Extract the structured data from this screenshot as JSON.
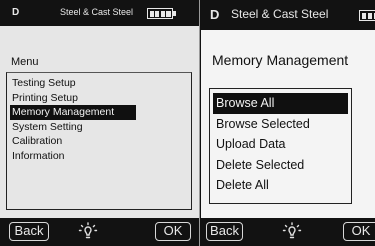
{
  "left_screen": {
    "status": {
      "mode": "D",
      "material": "Steel & Cast Steel",
      "battery_icon": "battery-full-icon"
    },
    "title": "Menu",
    "items": [
      {
        "label": "Testing Setup"
      },
      {
        "label": "Printing Setup"
      },
      {
        "label": "Memory Management"
      },
      {
        "label": "System Setting"
      },
      {
        "label": "Calibration"
      },
      {
        "label": "Information"
      }
    ],
    "selected_index": 2,
    "softkeys": {
      "back": "Back",
      "center_icon": "backlight-icon",
      "ok": "OK"
    }
  },
  "right_screen": {
    "status": {
      "mode": "D",
      "material": "Steel & Cast Steel",
      "battery_icon": "battery-full-icon"
    },
    "title": "Memory Management",
    "items": [
      {
        "label": "Browse All"
      },
      {
        "label": "Browse Selected"
      },
      {
        "label": "Upload Data"
      },
      {
        "label": "Delete Selected"
      },
      {
        "label": "Delete All"
      }
    ],
    "selected_index": 0,
    "softkeys": {
      "back": "Back",
      "center_icon": "backlight-icon",
      "ok": "OK"
    }
  },
  "colors": {
    "bar": "#121212",
    "screen_bg": "#e6e6e6",
    "highlight": "#101010",
    "highlight_text": "#f2f2f2"
  }
}
